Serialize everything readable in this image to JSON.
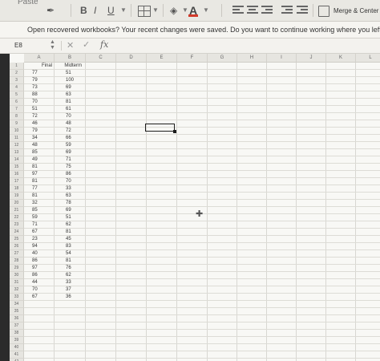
{
  "toolbar": {
    "paste_label": "Paste",
    "bold_label": "B",
    "italic_label": "I",
    "underline_label": "U",
    "font_color_label": "A",
    "merge_label": "Merge & Center"
  },
  "notification": {
    "text": "Open recovered workbooks?  Your recent changes were saved. Do you want to continue working where you left"
  },
  "formula_bar": {
    "cell_ref": "E8",
    "fx_label": "fx"
  },
  "columns": [
    "A",
    "B",
    "C",
    "D",
    "E",
    "F",
    "G",
    "H",
    "I",
    "J",
    "K",
    "L"
  ],
  "headers": {
    "col_a": "Final",
    "col_b": "Midterm"
  },
  "rows": [
    [
      "77",
      "51"
    ],
    [
      "79",
      "100"
    ],
    [
      "73",
      "69"
    ],
    [
      "88",
      "63"
    ],
    [
      "70",
      "81"
    ],
    [
      "51",
      "61"
    ],
    [
      "72",
      "70"
    ],
    [
      "46",
      "48"
    ],
    [
      "79",
      "72"
    ],
    [
      "34",
      "66"
    ],
    [
      "48",
      "59"
    ],
    [
      "85",
      "69"
    ],
    [
      "49",
      "71"
    ],
    [
      "81",
      "75"
    ],
    [
      "97",
      "86"
    ],
    [
      "81",
      "70"
    ],
    [
      "77",
      "33"
    ],
    [
      "81",
      "63"
    ],
    [
      "32",
      "78"
    ],
    [
      "85",
      "69"
    ],
    [
      "59",
      "51"
    ],
    [
      "71",
      "62"
    ],
    [
      "67",
      "81"
    ],
    [
      "23",
      "45"
    ],
    [
      "94",
      "83"
    ],
    [
      "40",
      "54"
    ],
    [
      "86",
      "81"
    ],
    [
      "97",
      "76"
    ],
    [
      "86",
      "62"
    ],
    [
      "44",
      "33"
    ],
    [
      "70",
      "37"
    ],
    [
      "67",
      "36"
    ]
  ],
  "row_numbers": [
    "1",
    "2",
    "3",
    "4",
    "5",
    "6",
    "7",
    "8",
    "9",
    "10",
    "11",
    "12",
    "13",
    "14",
    "15",
    "16",
    "17",
    "18",
    "19",
    "20",
    "21",
    "22",
    "23",
    "24",
    "25",
    "26",
    "27",
    "28",
    "29",
    "30",
    "31",
    "32",
    "33",
    "34",
    "35",
    "36",
    "37",
    "38",
    "39",
    "40",
    "41",
    "42"
  ]
}
